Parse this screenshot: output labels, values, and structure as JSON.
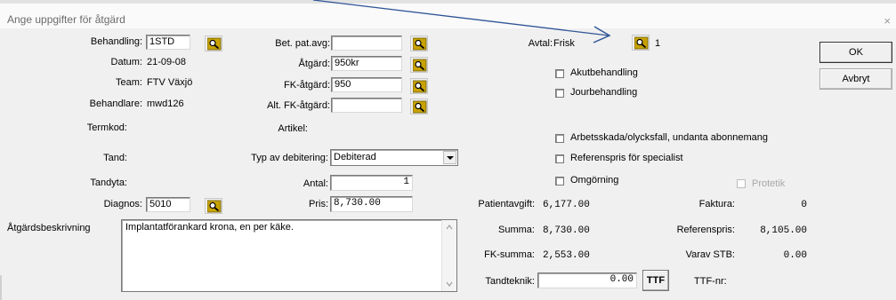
{
  "window": {
    "title": "Ange uppgifter för åtgärd",
    "close": "×"
  },
  "left": {
    "behandling_label": "Behandling:",
    "behandling_value": "1STD",
    "datum_label": "Datum:",
    "datum_value": "21-09-08",
    "team_label": "Team:",
    "team_value": "FTV Växjö",
    "behandlare_label": "Behandlare:",
    "behandlare_value": "mwd126",
    "termkod_label": "Termkod:",
    "tand_label": "Tand:",
    "tandyta_label": "Tandyta:",
    "diagnos_label": "Diagnos:",
    "diagnos_value": "5010"
  },
  "middle": {
    "betpat_label": "Bet. pat.avg:",
    "betpat_value": "",
    "atgard_label": "Åtgärd:",
    "atgard_value": "950kr",
    "fkatgard_label": "FK-åtgärd:",
    "fkatgard_value": "950",
    "altfk_label": "Alt. FK-åtgärd:",
    "altfk_value": "",
    "artikel_label": "Artikel:",
    "typ_label": "Typ av debitering:",
    "typ_value": "Debiterad",
    "antal_label": "Antal:",
    "antal_value": "1",
    "pris_label": "Pris:",
    "pris_value": "8,730.00"
  },
  "beskrivning": {
    "label": "Åtgärdsbeskrivning",
    "value": "Implantatförankard krona, en per käke."
  },
  "right": {
    "avtal_label": "Avtal:",
    "avtal_value": "Frisk",
    "avtal_count": "1",
    "akut_label": "Akutbehandling",
    "jour_label": "Jourbehandling",
    "arbete_label": "Arbetsskada/olycksfall, undanta abonnemang",
    "referens_label": "Referenspris för specialist",
    "omgorning_label": "Omgörning",
    "protetik_label": "Protetik",
    "patientavgift_label": "Patientavgift:",
    "patientavgift_value": "6,177.00",
    "faktura_label": "Faktura:",
    "faktura_value": "0",
    "summa_label": "Summa:",
    "summa_value": "8,730.00",
    "referenspris_label": "Referenspris:",
    "referenspris_value": "8,105.00",
    "fksumma_label": "FK-summa:",
    "fksumma_value": "2,553.00",
    "varav_label": "Varav STB:",
    "varav_value": "0.00",
    "tandteknik_label": "Tandteknik:",
    "tandteknik_value": "0.00",
    "ttf_button": "TTF",
    "ttfnr_label": "TTF-nr:"
  },
  "buttons": {
    "ok": "OK",
    "avbryt": "Avbryt"
  },
  "colors": {
    "annotation_arrow": "#2f5597",
    "lookup_icon": "#c8a200"
  }
}
